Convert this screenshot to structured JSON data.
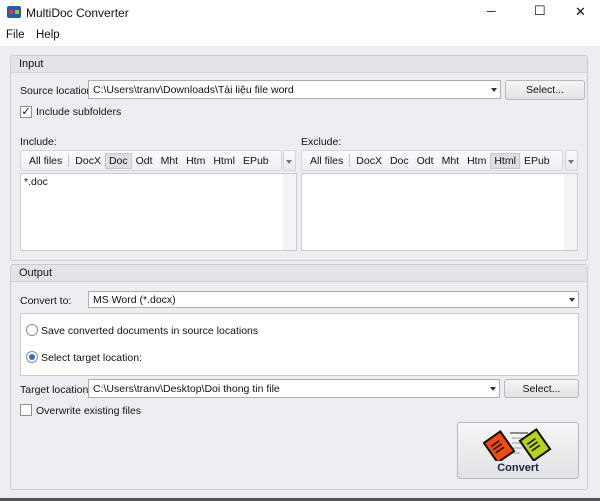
{
  "window": {
    "title": "MultiDoc Converter",
    "minimize": "─",
    "maximize": "☐",
    "close": "✕"
  },
  "menu": {
    "file": "File",
    "help": "Help"
  },
  "input": {
    "header": "Input",
    "source_label": "Source location:",
    "source_value": "C:\\Users\\tranv\\Downloads\\Tài liệu file word",
    "select_label": "Select...",
    "include_subfolders_label": "Include subfolders",
    "include_subfolders_checked": true,
    "include_label": "Include:",
    "exclude_label": "Exclude:",
    "filters": [
      "All files",
      "DocX",
      "Doc",
      "Odt",
      "Mht",
      "Htm",
      "Html",
      "EPub"
    ],
    "include_active": "Doc",
    "exclude_active": "Html",
    "include_items": [
      "*.doc"
    ],
    "exclude_items": []
  },
  "output": {
    "header": "Output",
    "convert_to_label": "Convert to:",
    "convert_to_value": "MS Word (*.docx)",
    "radio_source": "Save converted documents in source locations",
    "radio_target": "Select target location:",
    "selected_radio": "target",
    "target_label": "Target location:",
    "target_value": "C:\\Users\\tranv\\Desktop\\Doi thong tin file",
    "select_label": "Select...",
    "overwrite_label": "Overwrite existing files",
    "overwrite_checked": false,
    "convert_label": "Convert"
  },
  "colors": {
    "doc_red": "#f04a10",
    "doc_green": "#b5d31a"
  }
}
